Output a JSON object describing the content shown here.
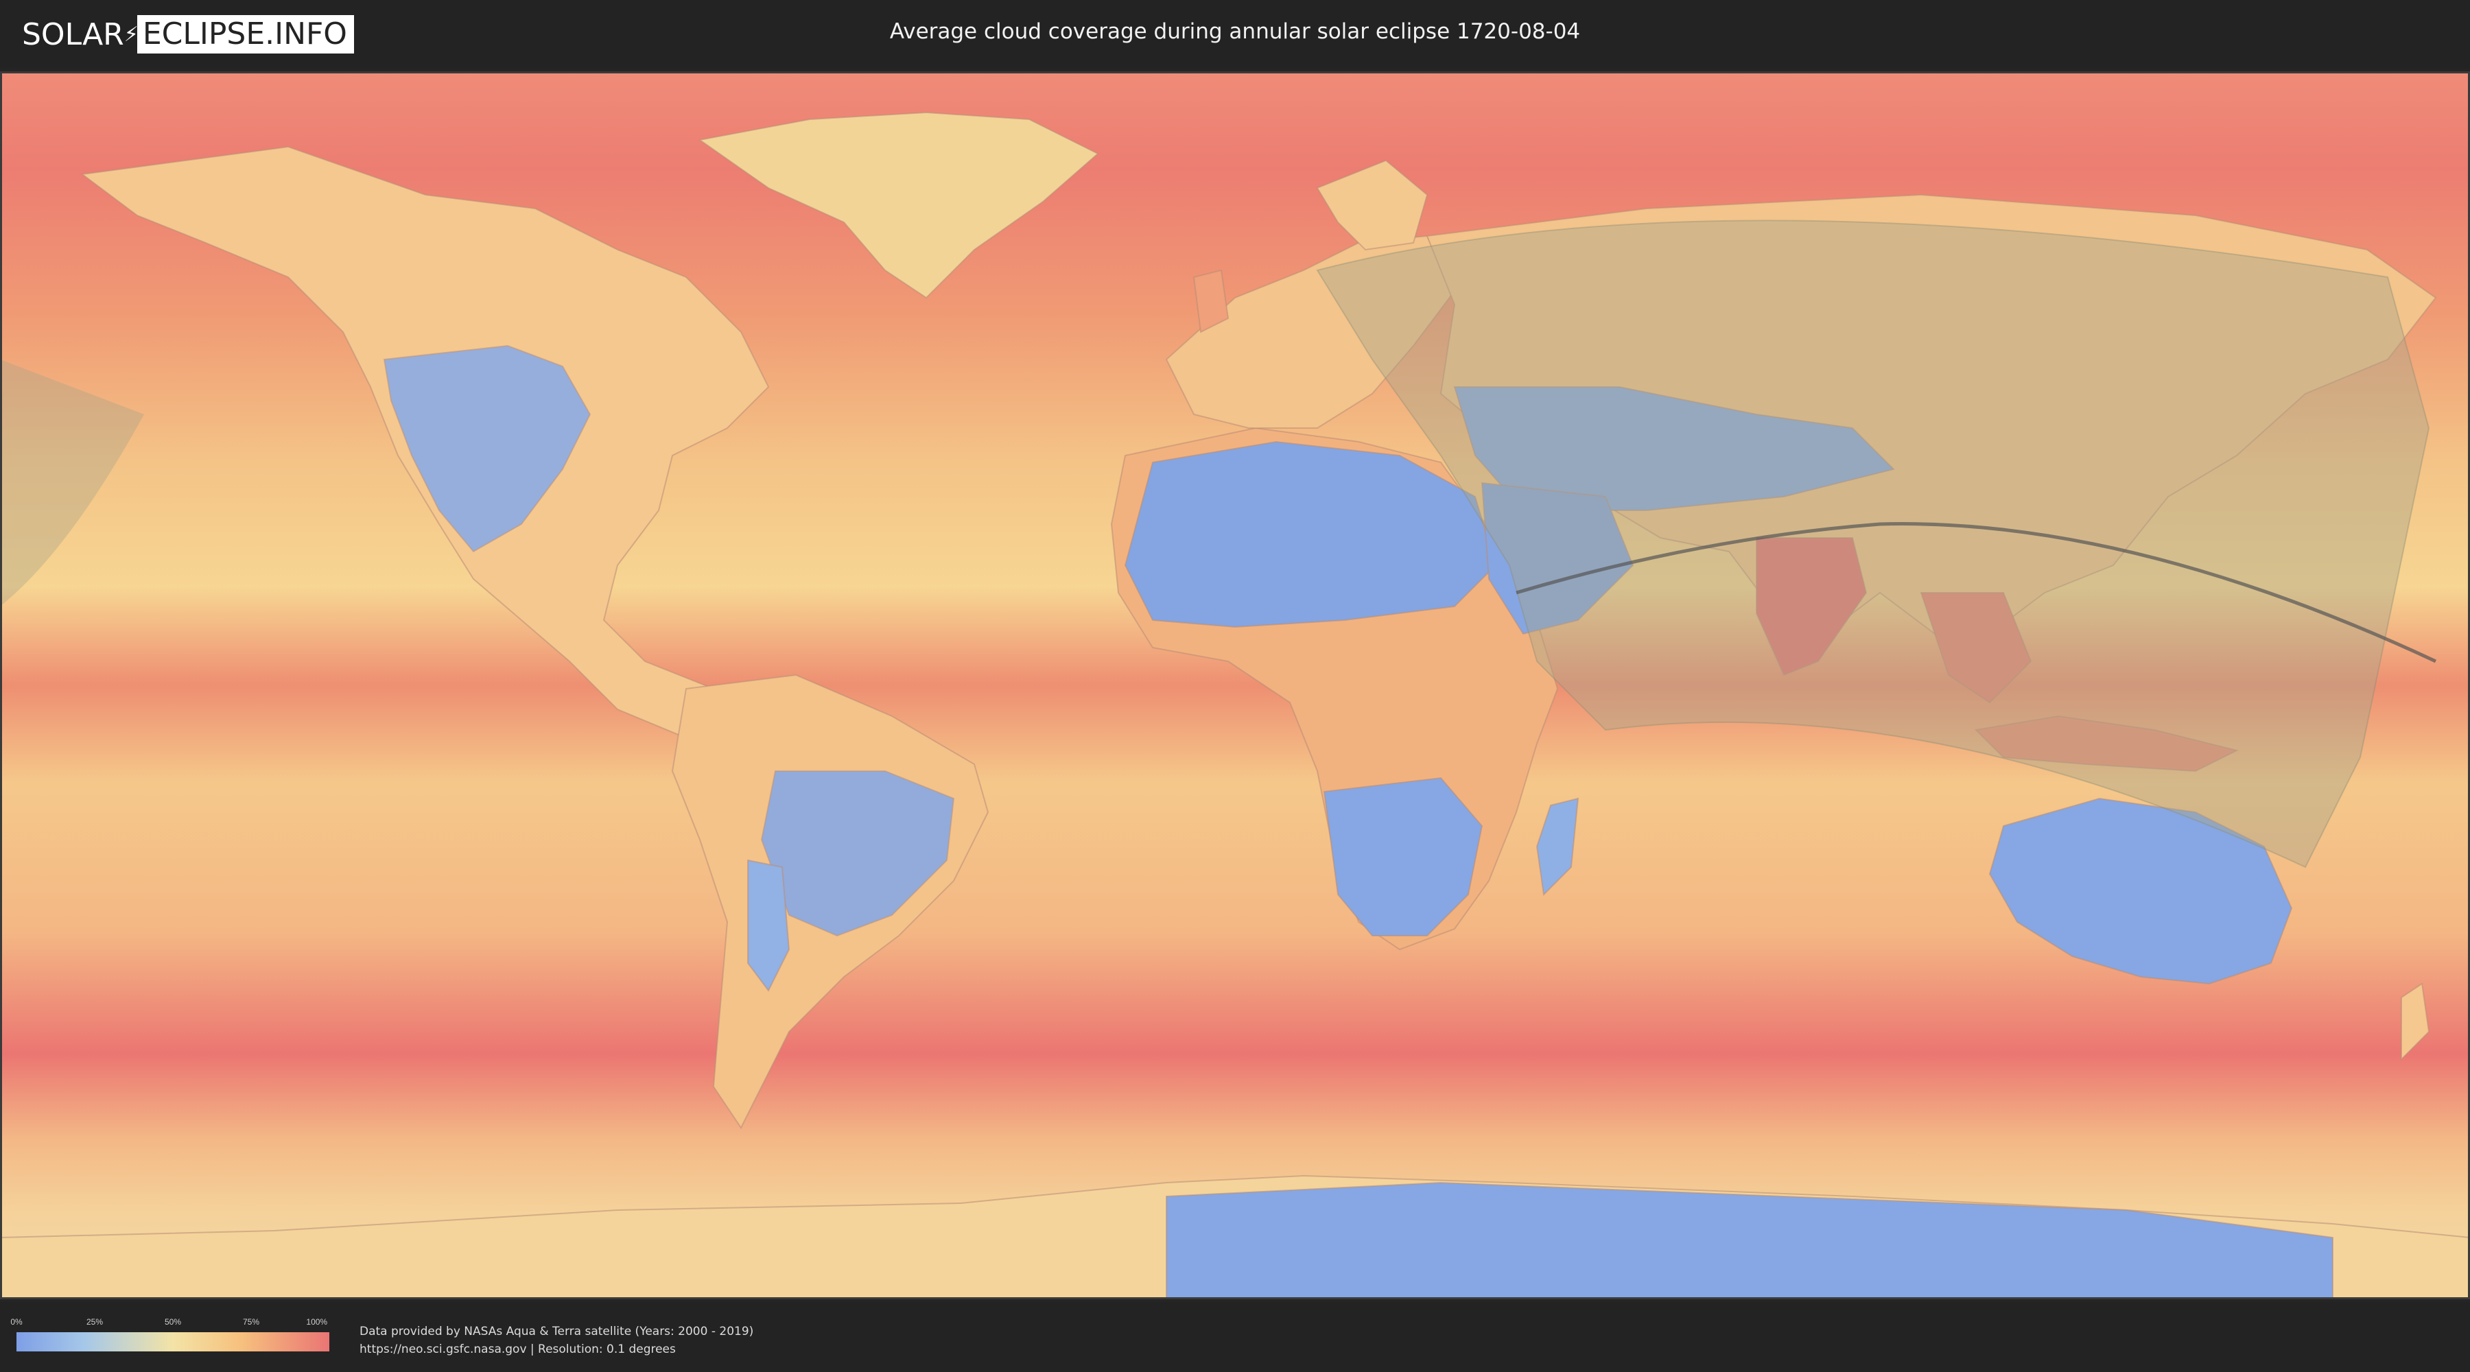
{
  "logo": {
    "left": "SOLAR",
    "right": "ECLIPSE.INFO"
  },
  "title": "Average cloud coverage during annular solar eclipse 1720-08-04",
  "legend": {
    "ticks": [
      "0%",
      "25%",
      "50%",
      "75%",
      "100%"
    ],
    "tick_values": [
      0,
      25,
      50,
      75,
      100
    ],
    "colors": {
      "low": "#7e9fe6",
      "mid": "#f3e3a6",
      "high": "#ea7574"
    }
  },
  "credits": {
    "line1": "Data provided by NASAs Aqua & Terra satellite (Years: 2000 - 2019)",
    "line2": "https://neo.sci.gsfc.nasa.gov | Resolution: 0.1 degrees"
  },
  "map": {
    "icon": "world-cloud-coverage-map",
    "ocean_color": "#f2a072",
    "clear_region_color": "#84a5e2",
    "eclipse_zone_color": "#a8a48a",
    "central_line_color": "#555555"
  }
}
